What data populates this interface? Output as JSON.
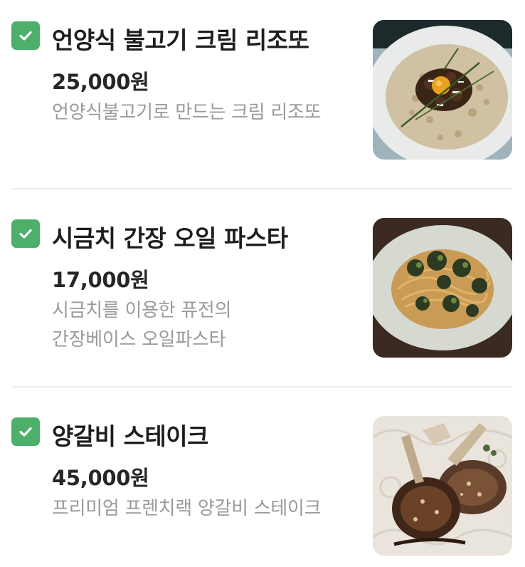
{
  "menu": {
    "items": [
      {
        "name": "언양식 불고기 크림 리조또",
        "price": "25,000원",
        "description": [
          "언양식불고기로 만드는 크림 리조또"
        ],
        "checked": true,
        "photo_icon": "risotto-photo"
      },
      {
        "name": "시금치 간장 오일 파스타",
        "price": "17,000원",
        "description": [
          "시금치를 이용한 퓨전의",
          "간장베이스 오일파스타"
        ],
        "checked": true,
        "photo_icon": "pasta-photo"
      },
      {
        "name": "양갈비 스테이크",
        "price": "45,000원",
        "description": [
          "프리미엄 프렌치랙 양갈비 스테이크"
        ],
        "checked": true,
        "photo_icon": "lamb-steak-photo"
      }
    ]
  },
  "colors": {
    "check_green": "#4caf6a",
    "title_text": "#1e1e1e",
    "desc_text": "#9a9a9a",
    "divider": "#ececec"
  }
}
